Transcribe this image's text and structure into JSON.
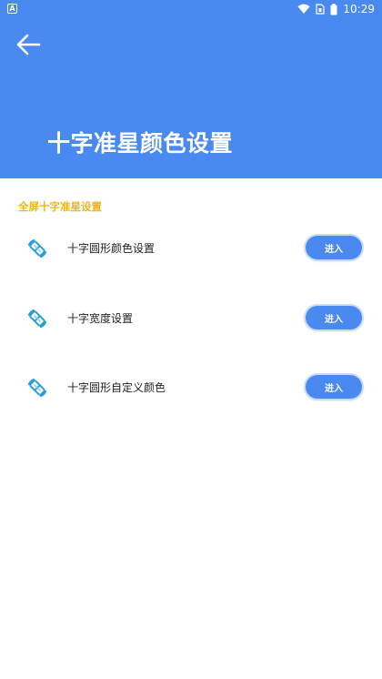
{
  "status_bar": {
    "app_indicator": "A",
    "time": "10:29",
    "icons": [
      "wifi-icon",
      "sim-icon",
      "battery-icon"
    ]
  },
  "header": {
    "back_icon": "arrow-left-icon",
    "title": "十字准星颜色设置",
    "color": "#4a8af0"
  },
  "section": {
    "label": "全屏十字准星设置",
    "label_color": "#f0b418"
  },
  "items": [
    {
      "icon": "crosshair-settings-icon",
      "label": "十字圆形颜色设置",
      "button": "进入"
    },
    {
      "icon": "crosshair-settings-icon",
      "label": "十字宽度设置",
      "button": "进入"
    },
    {
      "icon": "crosshair-settings-icon",
      "label": "十字圆形自定义颜色",
      "button": "进入"
    }
  ]
}
